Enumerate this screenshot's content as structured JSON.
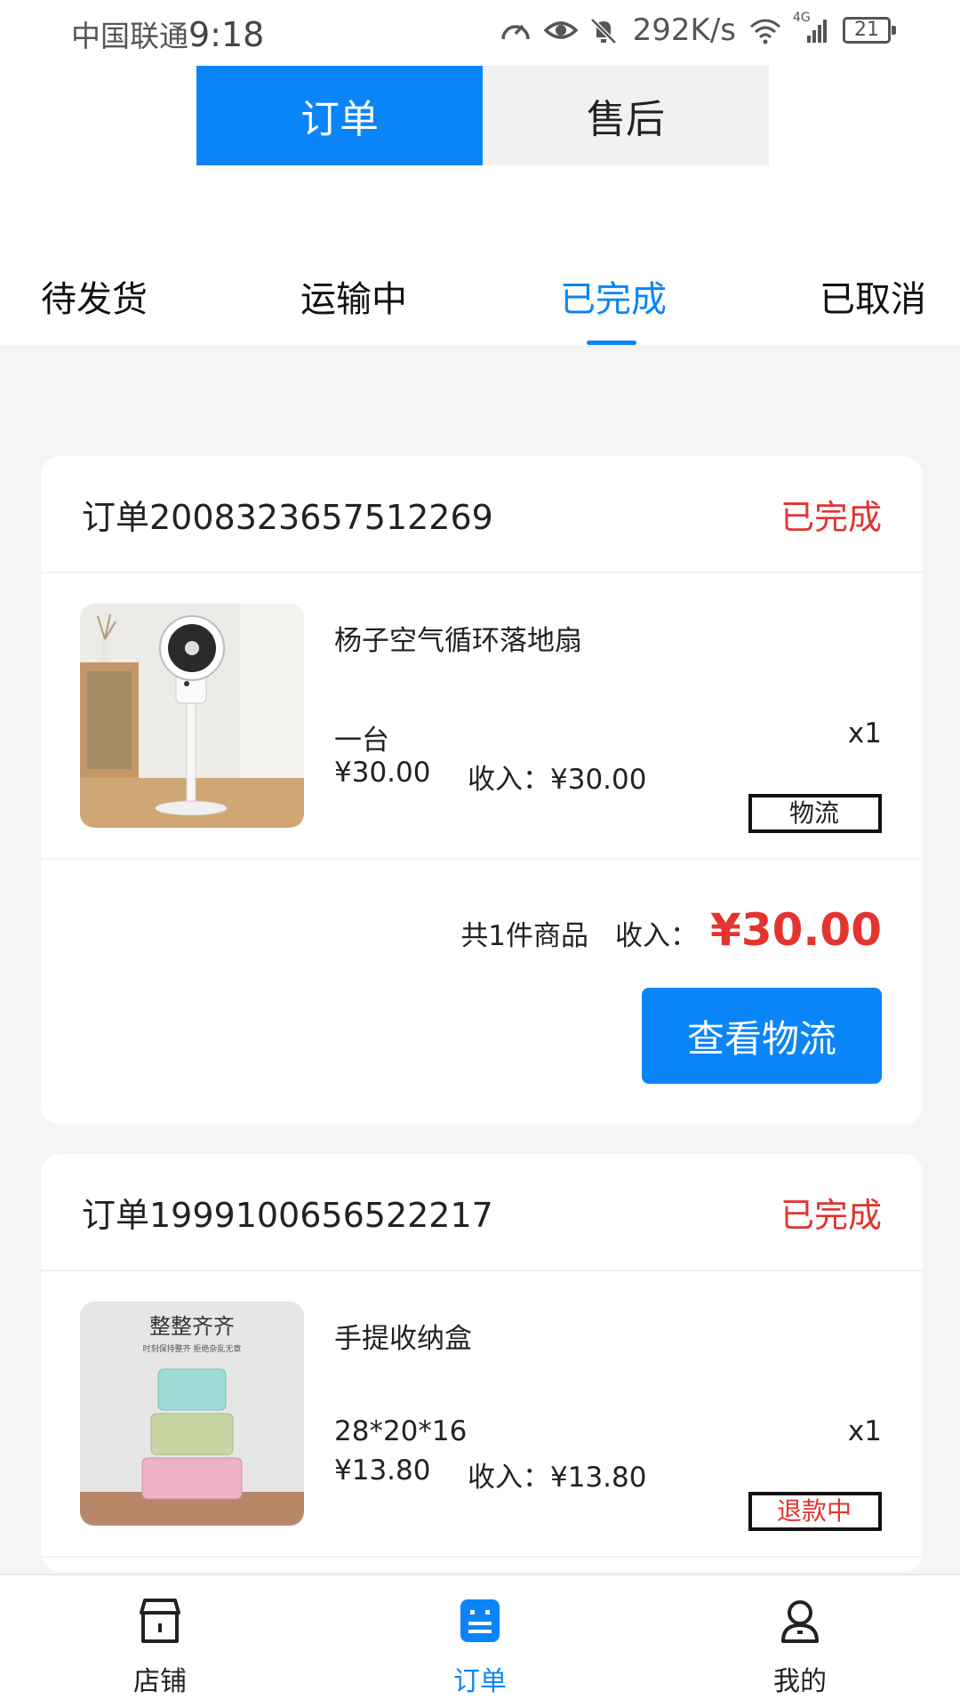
{
  "status_bar": {
    "carrier": "中国联通",
    "time": "9:18",
    "speed": "292K/s",
    "network": "4G",
    "battery": "21",
    "icons": [
      "speedometer-icon",
      "eye-icon",
      "bell-muted-icon",
      "wifi-icon",
      "signal-icon",
      "battery-icon"
    ]
  },
  "top_toggle": {
    "tabs": [
      {
        "label": "订单",
        "active": true
      },
      {
        "label": "售后",
        "active": false
      }
    ]
  },
  "status_tabs": {
    "tabs": [
      {
        "label": "待发货",
        "active": false
      },
      {
        "label": "运输中",
        "active": false
      },
      {
        "label": "已完成",
        "active": true
      },
      {
        "label": "已取消",
        "active": false
      }
    ]
  },
  "orders": [
    {
      "order_no": "订单2008323657512269",
      "status": "已完成",
      "item": {
        "title": "杨子空气循环落地扇",
        "spec": "一台",
        "price": "¥30.00",
        "income": "收入：¥30.00",
        "qty": "x1",
        "tag": "物流"
      },
      "summary": {
        "count": "共1件商品",
        "income_label": "收入：",
        "total": "¥30.00"
      },
      "button": "查看物流"
    },
    {
      "order_no": "订单1999100656522217",
      "status": "已完成",
      "item": {
        "title": "手提收纳盒",
        "image_caption": "整整齐齐",
        "image_subcaption": "时刻保持整齐 拒绝杂乱无章",
        "spec": "28*20*16",
        "price": "¥13.80",
        "income": "收入：¥13.80",
        "qty": "x1",
        "tag": "退款中"
      }
    }
  ],
  "bottom_nav": {
    "items": [
      {
        "label": "店铺",
        "icon": "store-icon",
        "active": false
      },
      {
        "label": "订单",
        "icon": "orders-icon",
        "active": true
      },
      {
        "label": "我的",
        "icon": "profile-icon",
        "active": false
      }
    ]
  },
  "colors": {
    "accent": "#0a85f7",
    "status_red": "#e3342f",
    "background": "#f5f5f5"
  }
}
